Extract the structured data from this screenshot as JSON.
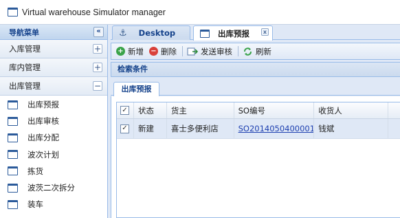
{
  "window": {
    "title": "Virtual warehouse Simulator manager"
  },
  "sidebar": {
    "title": "导航菜单",
    "collapse_glyph": "«",
    "sections": [
      {
        "label": "入库管理",
        "toggle": "+"
      },
      {
        "label": "库内管理",
        "toggle": "+"
      },
      {
        "label": "出库管理",
        "toggle": "−"
      }
    ],
    "items": [
      {
        "label": "出库预报"
      },
      {
        "label": "出库审核"
      },
      {
        "label": "出库分配"
      },
      {
        "label": "波次计划"
      },
      {
        "label": "拣货"
      },
      {
        "label": "波茨二次拆分"
      },
      {
        "label": "装车"
      }
    ]
  },
  "tabs": {
    "desktop": {
      "label": "Desktop",
      "icon": "anchor-icon"
    },
    "active": {
      "label": "出库预报",
      "close": "x"
    }
  },
  "toolbar": {
    "add": {
      "label": "新增",
      "icon": "add-icon",
      "color": "#3aa34a"
    },
    "delete": {
      "label": "删除",
      "icon": "delete-icon",
      "color": "#d9413b"
    },
    "send": {
      "label": "发送审核",
      "icon": "send-icon"
    },
    "refresh": {
      "label": "刷新",
      "icon": "refresh-icon"
    }
  },
  "search": {
    "label": "检索条件"
  },
  "grid_tab": {
    "label": "出库预报"
  },
  "grid": {
    "columns": [
      "状态",
      "货主",
      "SO编号",
      "收货人",
      ""
    ],
    "rows": [
      {
        "checked": true,
        "status": "新建",
        "owner": "喜士多便利店",
        "so": "SO2014050400001",
        "receiver": "钱斌",
        "extra": ""
      }
    ]
  }
}
